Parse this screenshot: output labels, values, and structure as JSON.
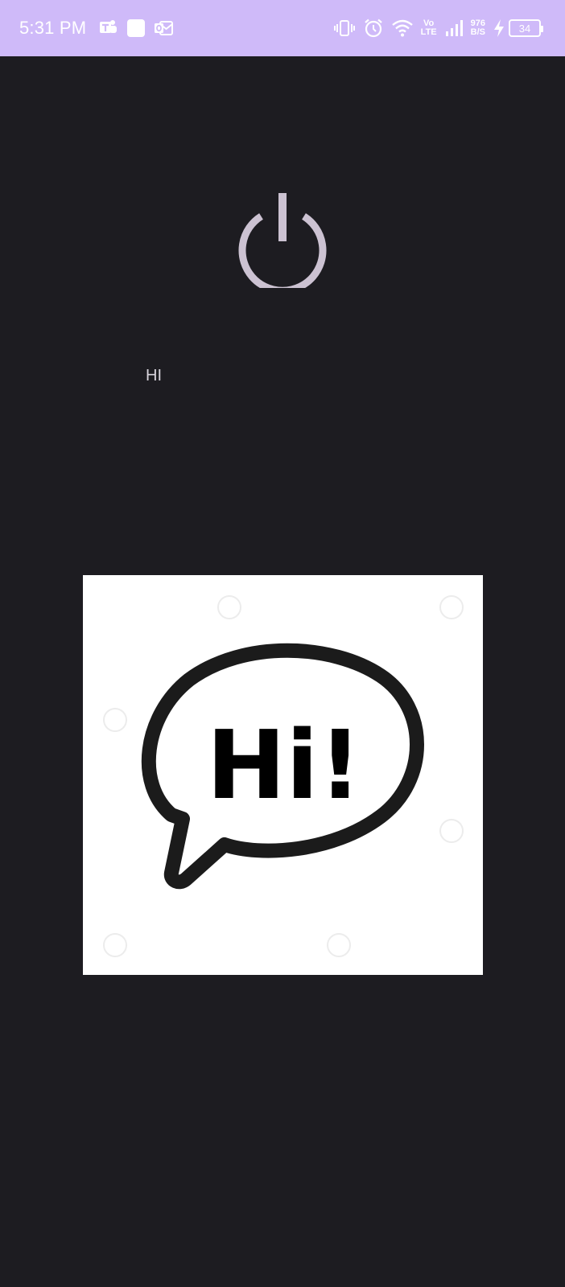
{
  "status_bar": {
    "time": "5:31 PM",
    "network": {
      "vo": "Vo",
      "lte": "LTE"
    },
    "data_rate": {
      "value": "976",
      "unit": "B/S"
    },
    "battery_level": "34",
    "background_color": "#cfbaf9",
    "left_icons": [
      "teams-icon",
      "notification-square-icon",
      "outlook-icon"
    ],
    "right_icons": [
      "vibrate-icon",
      "alarm-icon",
      "wifi-icon",
      "volte-icon",
      "signal-icon",
      "data-rate",
      "charging-icon",
      "battery-icon"
    ]
  },
  "main": {
    "power_icon": "power-icon",
    "power_icon_color": "#ccc2d2",
    "label": "HI",
    "image": {
      "icon": "speech-bubble-icon",
      "text": "Hi!"
    },
    "background_color": "#1d1c21"
  }
}
